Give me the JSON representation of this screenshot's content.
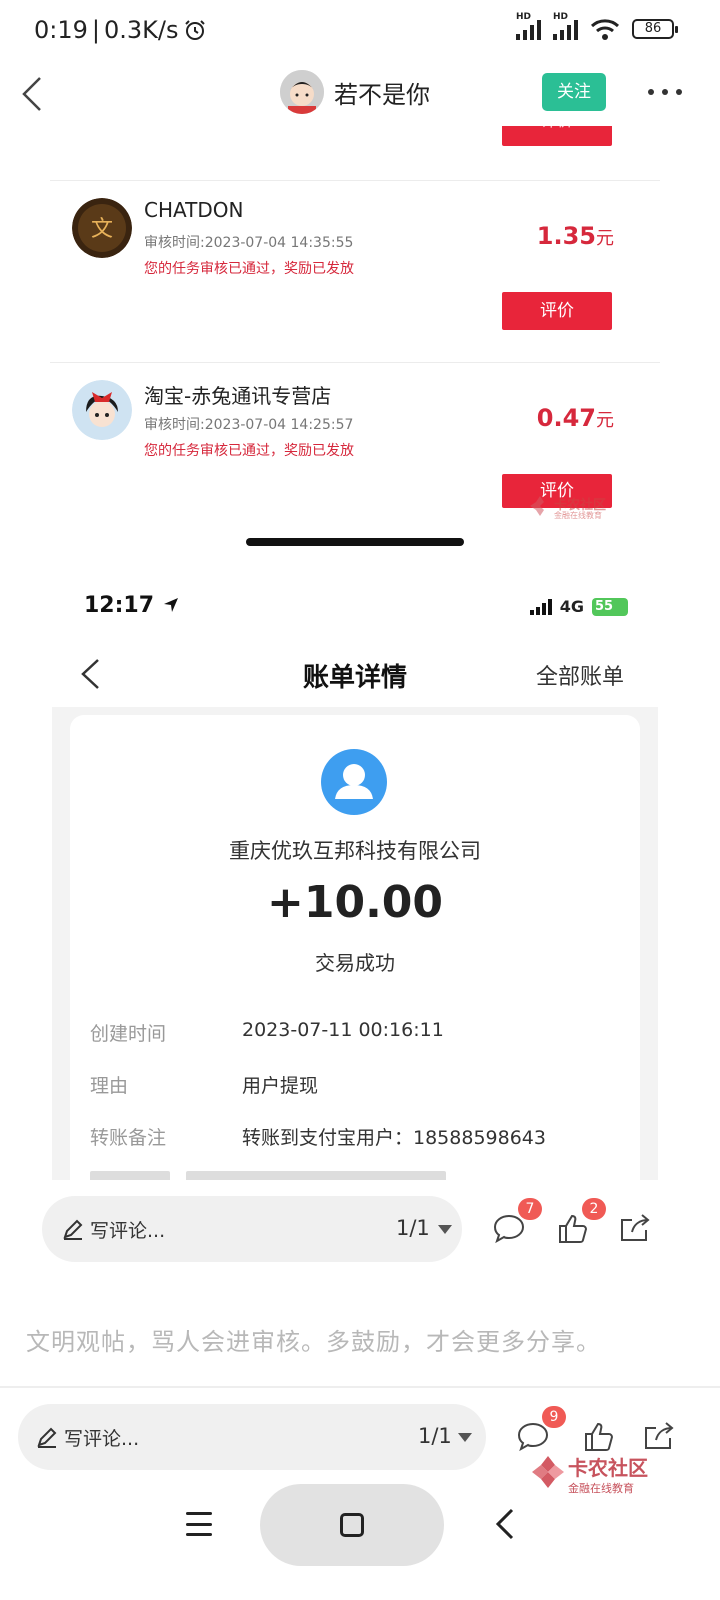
{
  "status_bar": {
    "time": "0:19",
    "speed": "0.3K/s",
    "battery": "86",
    "hd1": "HD",
    "hd2": "HD"
  },
  "nav": {
    "author_name": "若不是你",
    "follow_label": "关注"
  },
  "embedded_tasks": {
    "partial_button_label": "评价",
    "items": [
      {
        "title": "CHATDON",
        "time": "审核时间:2023-07-04 14:35:55",
        "status": "您的任务审核已通过，奖励已发放",
        "amount": "1.35",
        "unit": "元",
        "review_label": "评价"
      },
      {
        "title": "淘宝-赤兔通讯专营店",
        "time": "审核时间:2023-07-04 14:25:57",
        "status": "您的任务审核已通过，奖励已发放",
        "amount": "0.47",
        "unit": "元",
        "review_label": "评价"
      }
    ],
    "watermark": {
      "name": "卡农社区",
      "sub": "金融在线教育"
    }
  },
  "embedded_bill": {
    "ios_time": "12:17",
    "ios_net": "4G",
    "ios_battery": "55",
    "title": "账单详情",
    "all_bills": "全部账单",
    "payer": "重庆优玖互邦科技有限公司",
    "amount": "+10.00",
    "status": "交易成功",
    "rows": [
      {
        "key": "创建时间",
        "value": "2023-07-11 00:16:11"
      },
      {
        "key": "理由",
        "value": "用户提现"
      },
      {
        "key": "转账备注",
        "value": "转账到支付宝用户：18588598643"
      }
    ]
  },
  "comment_bar_inner": {
    "placeholder": "写评论...",
    "pager": "1/1",
    "comment_badge": "7",
    "like_badge": "2"
  },
  "civility_notice": "文明观帖，骂人会进审核。多鼓励，才会更多分享。",
  "comment_bar": {
    "placeholder": "写评论...",
    "pager": "1/1",
    "comment_badge": "9"
  },
  "watermark": {
    "name": "卡农社区",
    "sub": "金融在线教育"
  },
  "colors": {
    "accent_green": "#2bbf95",
    "accent_red": "#e8253a",
    "badge_red": "#f05a55",
    "alipay_blue": "#3e9ef0"
  }
}
